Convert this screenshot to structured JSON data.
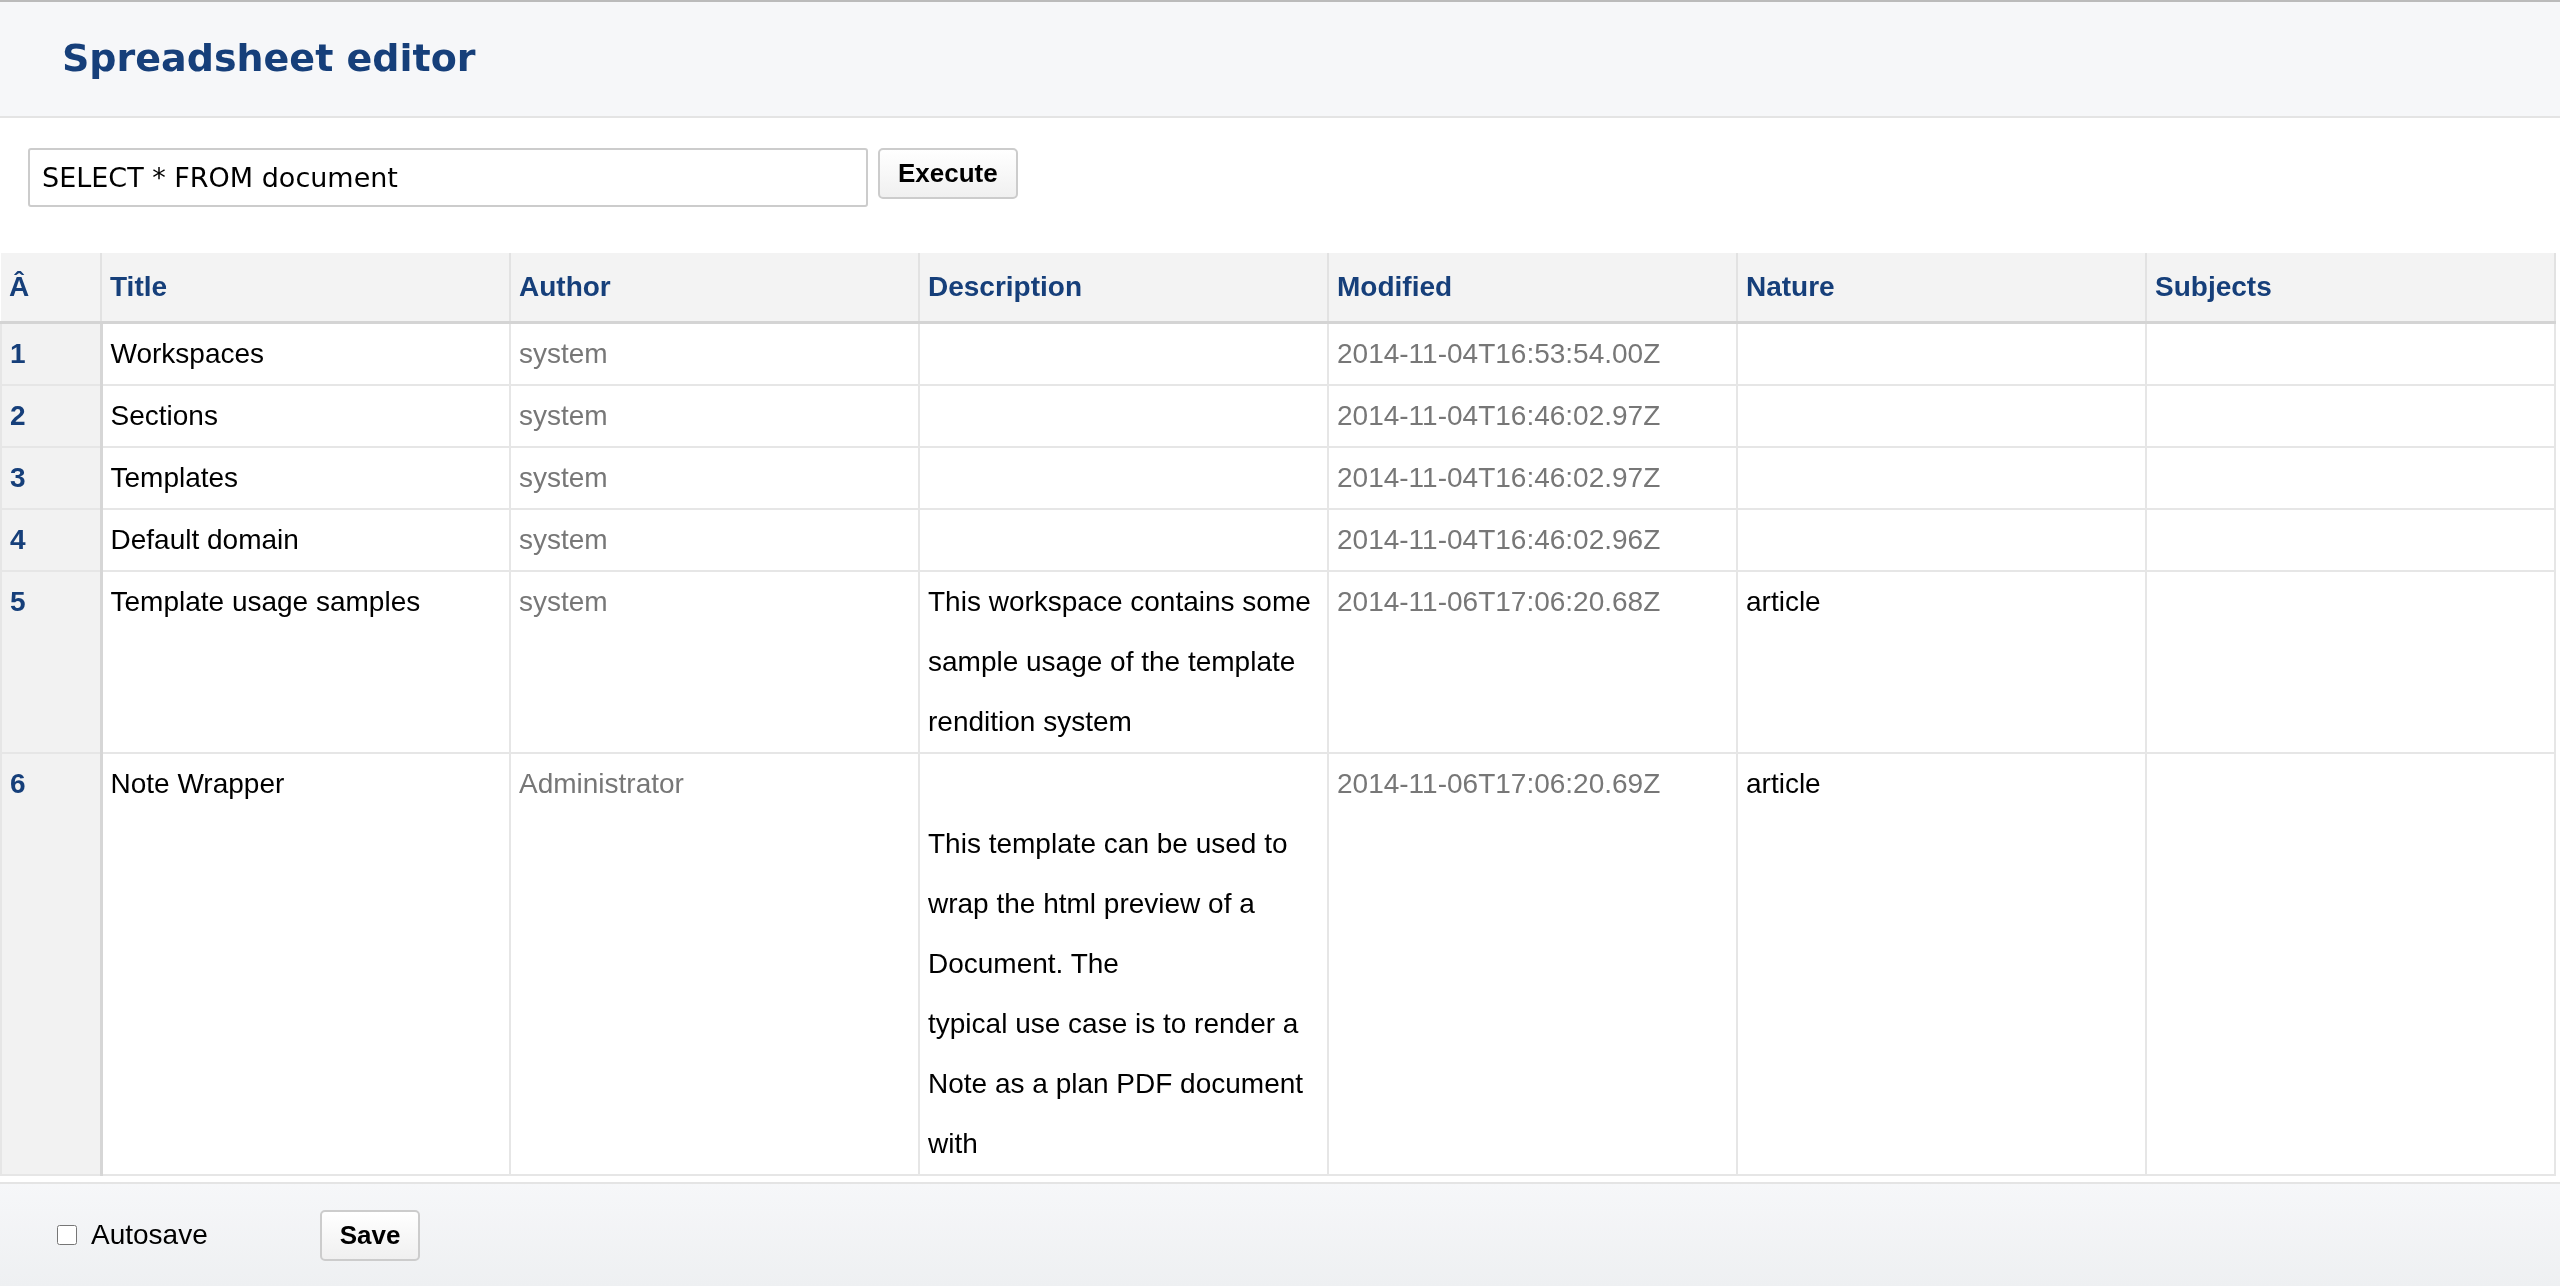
{
  "page_title": "Spreadsheet editor",
  "query": {
    "value": "SELECT * FROM document",
    "button": "Execute"
  },
  "table": {
    "corner": "Â",
    "columns": [
      "Title",
      "Author",
      "Description",
      "Modified",
      "Nature",
      "Subjects"
    ],
    "rows": [
      {
        "number": "1",
        "title": "Workspaces",
        "author": "system",
        "modified": "2014-11-04T16:53:54.00Z"
      },
      {
        "number": "2",
        "title": "Sections",
        "author": "system",
        "modified": "2014-11-04T16:46:02.97Z"
      },
      {
        "number": "3",
        "title": "Templates",
        "author": "system",
        "modified": "2014-11-04T16:46:02.97Z"
      },
      {
        "number": "4",
        "title": "Default domain",
        "author": "system",
        "modified": "2014-11-04T16:46:02.96Z"
      },
      {
        "number": "5",
        "title": "Template usage samples",
        "author": "system",
        "description": "This workspace contains some sample usage of the template rendition system",
        "modified": "2014-11-06T17:06:20.68Z",
        "nature": "article"
      },
      {
        "number": "6",
        "title": "Note Wrapper",
        "author": "Administrator",
        "description": "\nThis template can be used to wrap the html preview of a Document. The\ntypical use case is to render a Note as a plan PDF document with",
        "modified": "2014-11-06T17:06:20.69Z",
        "nature": "article"
      }
    ]
  },
  "footer": {
    "autosave": {
      "label": "Autosave",
      "checked": false
    },
    "save_button": "Save"
  }
}
